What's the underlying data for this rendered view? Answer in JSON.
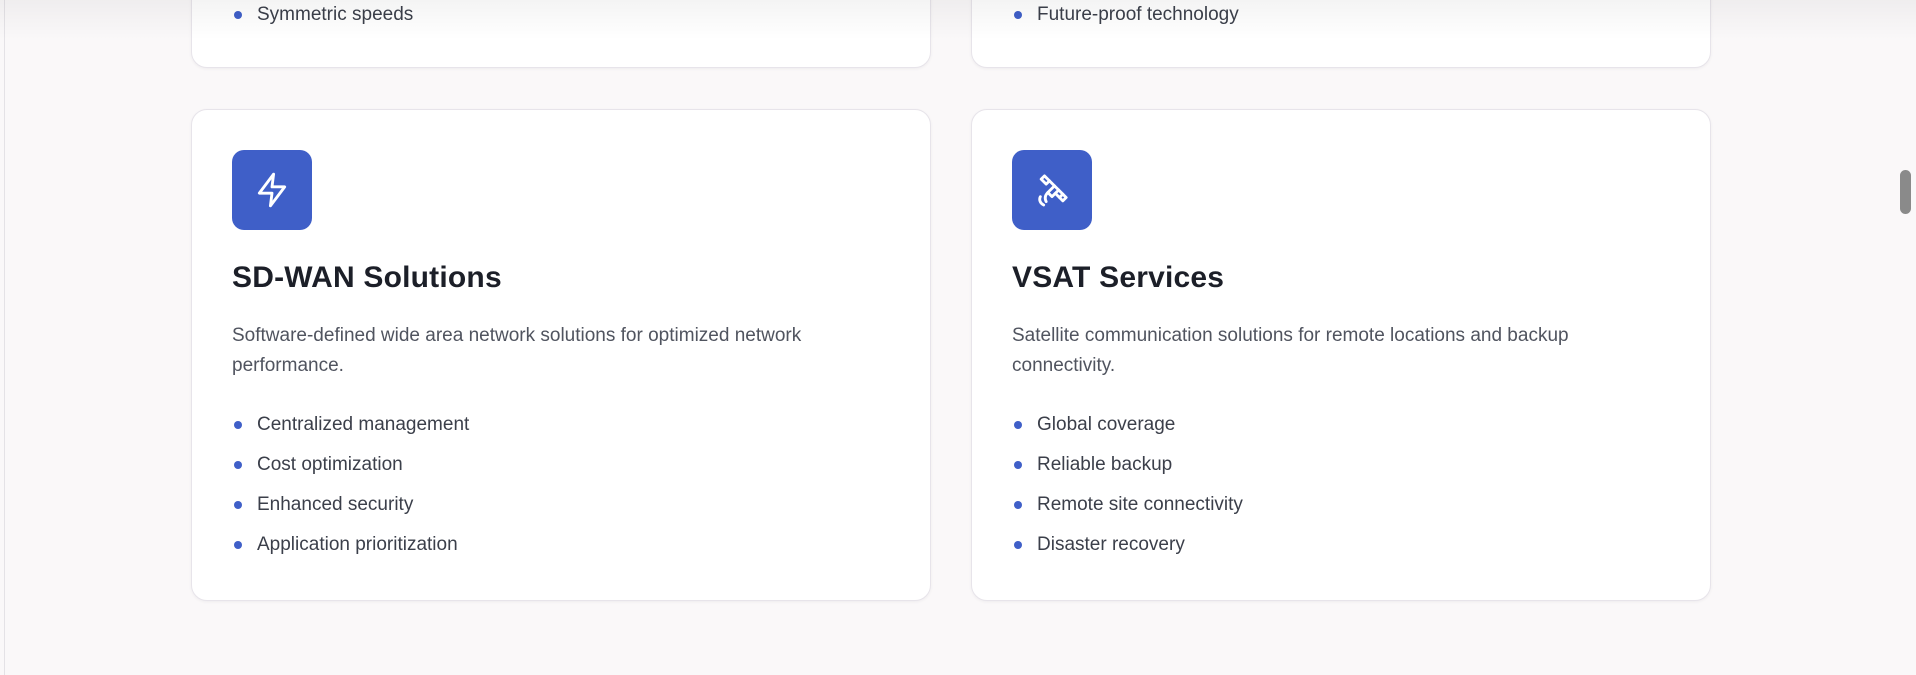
{
  "top_cards": [
    {
      "items": [
        "Symmetric speeds"
      ]
    },
    {
      "items": [
        "Future-proof technology"
      ]
    }
  ],
  "cards": [
    {
      "icon": "lightning-icon",
      "title": "SD-WAN Solutions",
      "description": "Software-defined wide area network solutions for optimized network performance.",
      "features": [
        "Centralized management",
        "Cost optimization",
        "Enhanced security",
        "Application prioritization"
      ]
    },
    {
      "icon": "satellite-icon",
      "title": "VSAT Services",
      "description": "Satellite communication solutions for remote locations and backup connectivity.",
      "features": [
        "Global coverage",
        "Reliable backup",
        "Remote site connectivity",
        "Disaster recovery"
      ]
    }
  ],
  "colors": {
    "accent": "#3f5fc8",
    "page_background": "#faf8f9",
    "card_background": "#ffffff",
    "heading": "#1c1f28",
    "body_text": "#50545f"
  }
}
